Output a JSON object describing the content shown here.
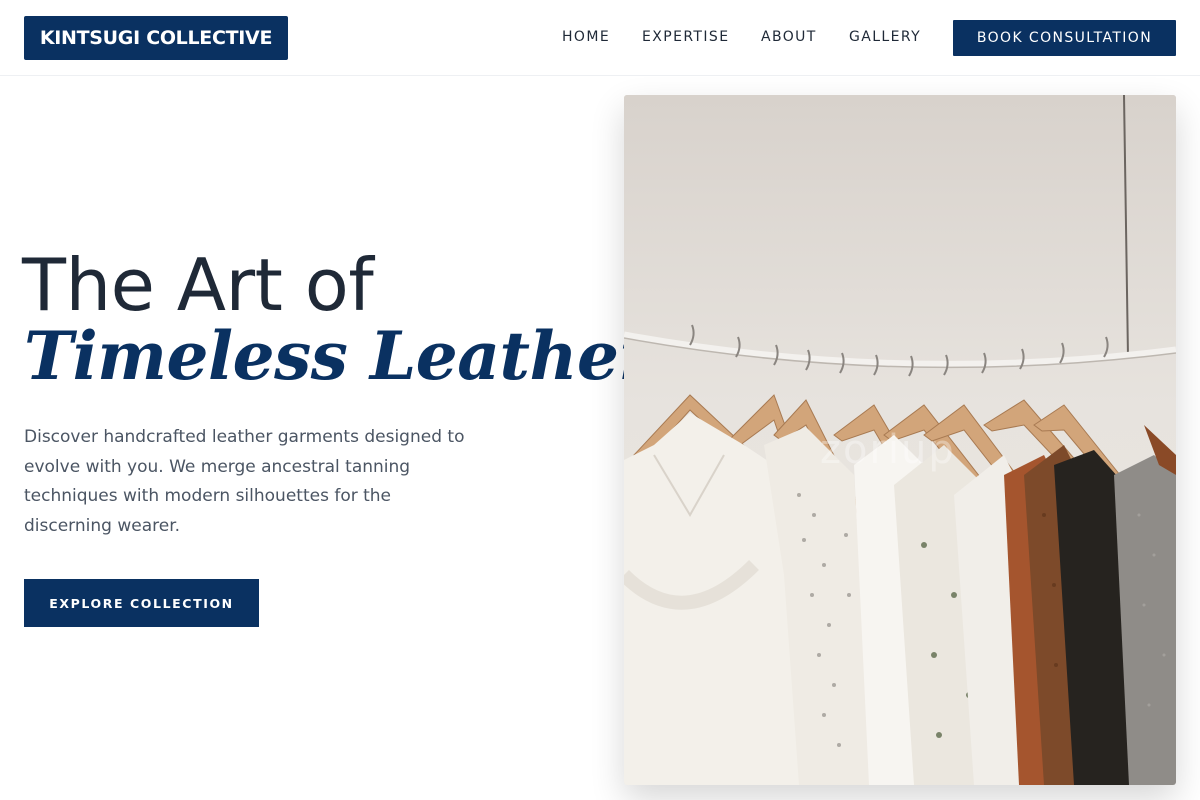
{
  "brand": {
    "name": "KINTSUGI COLLECTIVE"
  },
  "nav": {
    "items": [
      "HOME",
      "EXPERTISE",
      "ABOUT",
      "GALLERY"
    ],
    "cta": "BOOK CONSULTATION"
  },
  "hero": {
    "title_line1": "The Art of",
    "title_line2": "Timeless Leather",
    "description": "Discover handcrafted leather garments designed to evolve with you. We merge ancestral tanning techniques with modern silhouettes for the discerning wearer.",
    "cta": "EXPLORE COLLECTION",
    "image": {
      "subject": "clothing rack with garments on wooden hangers",
      "watermark": "zoriup"
    }
  },
  "colors": {
    "brand_navy": "#0a3161",
    "heading_dark": "#1f2937",
    "body_gray": "#4b5563",
    "background": "#ffffff"
  }
}
